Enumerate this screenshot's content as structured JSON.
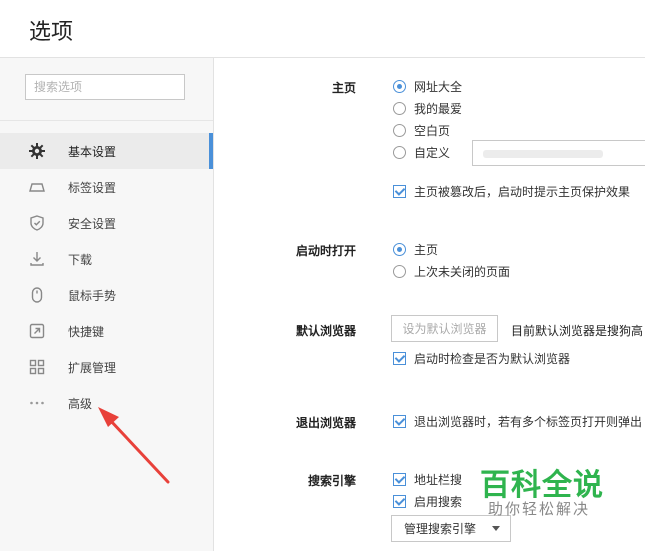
{
  "window": {
    "title": "选项"
  },
  "sidebar": {
    "search_placeholder": "搜索选项",
    "items": [
      {
        "label": "基本设置",
        "icon": "gear-icon",
        "active": true
      },
      {
        "label": "标签设置",
        "icon": "tab-icon",
        "active": false
      },
      {
        "label": "安全设置",
        "icon": "shield-icon",
        "active": false
      },
      {
        "label": "下载",
        "icon": "download-icon",
        "active": false
      },
      {
        "label": "鼠标手势",
        "icon": "mouse-icon",
        "active": false
      },
      {
        "label": "快捷键",
        "icon": "shortcut-icon",
        "active": false
      },
      {
        "label": "扩展管理",
        "icon": "extensions-icon",
        "active": false
      },
      {
        "label": "高级",
        "icon": "more-icon",
        "active": false
      }
    ]
  },
  "main": {
    "homepage": {
      "label": "主页",
      "options": [
        "网址大全",
        "我的最爱",
        "空白页",
        "自定义"
      ],
      "selected": "网址大全",
      "protect_label": "主页被篡改后，启动时提示主页保护效果"
    },
    "startup": {
      "label": "启动时打开",
      "options": [
        "主页",
        "上次未关闭的页面"
      ],
      "selected": "主页"
    },
    "default_browser": {
      "label": "默认浏览器",
      "button": "设为默认浏览器",
      "status": "目前默认浏览器是搜狗高",
      "check_label": "启动时检查是否为默认浏览器"
    },
    "exit": {
      "label": "退出浏览器",
      "check_label": "退出浏览器时，若有多个标签页打开则弹出"
    },
    "search_engine": {
      "label": "搜索引擎",
      "check1": "地址栏搜",
      "check2": "启用搜索",
      "manage_button": "管理搜索引擎"
    }
  },
  "watermark": {
    "main": "百科全说",
    "sub": "助你轻松解决"
  },
  "colors": {
    "accent": "#4a90d9",
    "arrow": "#e8413a",
    "watermark": "#2fb44e"
  }
}
